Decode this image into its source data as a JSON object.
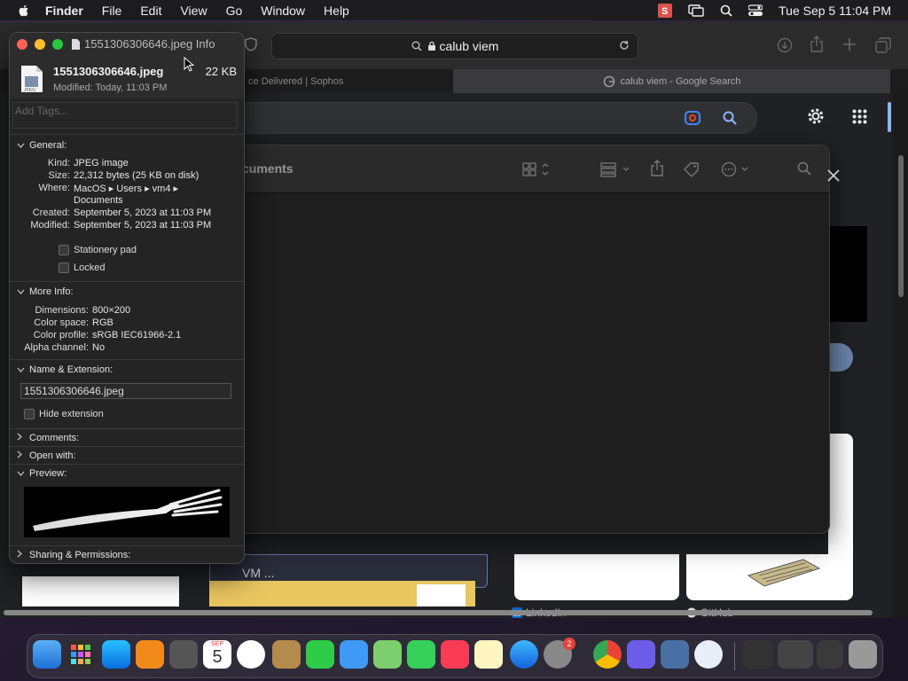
{
  "menubar": {
    "app_name": "Finder",
    "items": [
      "File",
      "Edit",
      "View",
      "Go",
      "Window",
      "Help"
    ],
    "clock": "Tue Sep 5  11:04 PM"
  },
  "safari": {
    "url": "calub viem",
    "tabs": [
      {
        "label": "ce Delivered | Sophos"
      },
      {
        "label": "calub viem - Google Search"
      }
    ]
  },
  "finder_window": {
    "title": "cuments"
  },
  "info_window": {
    "title": "1551306306646.jpeg Info",
    "file_name": "1551306306646.jpeg",
    "file_size": "22 KB",
    "modified": "Modified: Today, 11:03 PM",
    "tags_placeholder": "Add Tags...",
    "general": {
      "label": "General:",
      "rows": [
        {
          "k": "Kind:",
          "v": "JPEG image"
        },
        {
          "k": "Size:",
          "v": "22,312 bytes (25 KB on disk)"
        },
        {
          "k": "Where:",
          "v": "MacOS ▸ Users ▸ vm4 ▸"
        },
        {
          "k": "",
          "v": "Documents"
        },
        {
          "k": "Created:",
          "v": "September 5, 2023 at 11:03 PM"
        },
        {
          "k": "Modified:",
          "v": "September 5, 2023 at 11:03 PM"
        }
      ],
      "stationery": "Stationery pad",
      "locked": "Locked"
    },
    "more_info": {
      "label": "More Info:",
      "rows": [
        {
          "k": "Dimensions:",
          "v": "800×200"
        },
        {
          "k": "Color space:",
          "v": "RGB"
        },
        {
          "k": "Color profile:",
          "v": "sRGB IEC61966-2.1"
        },
        {
          "k": "Alpha channel:",
          "v": "No"
        }
      ]
    },
    "name_ext": {
      "label": "Name & Extension:",
      "value": "1551306306646.jpeg",
      "hide_ext": "Hide extension"
    },
    "comments": "Comments:",
    "open_with": "Open with:",
    "preview": "Preview:",
    "sharing": "Sharing & Permissions:"
  },
  "page": {
    "left_card_text": "VM ...",
    "linkedin": "LinkedIn",
    "github": "GitHub"
  },
  "dock": {
    "calendar_month": "SEP",
    "calendar_day": "5",
    "settings_badge": "2"
  },
  "colors": {
    "close": "#ff5f57",
    "minimize": "#febc2e",
    "zoom": "#28c840",
    "accent": "#8ab4f8"
  }
}
